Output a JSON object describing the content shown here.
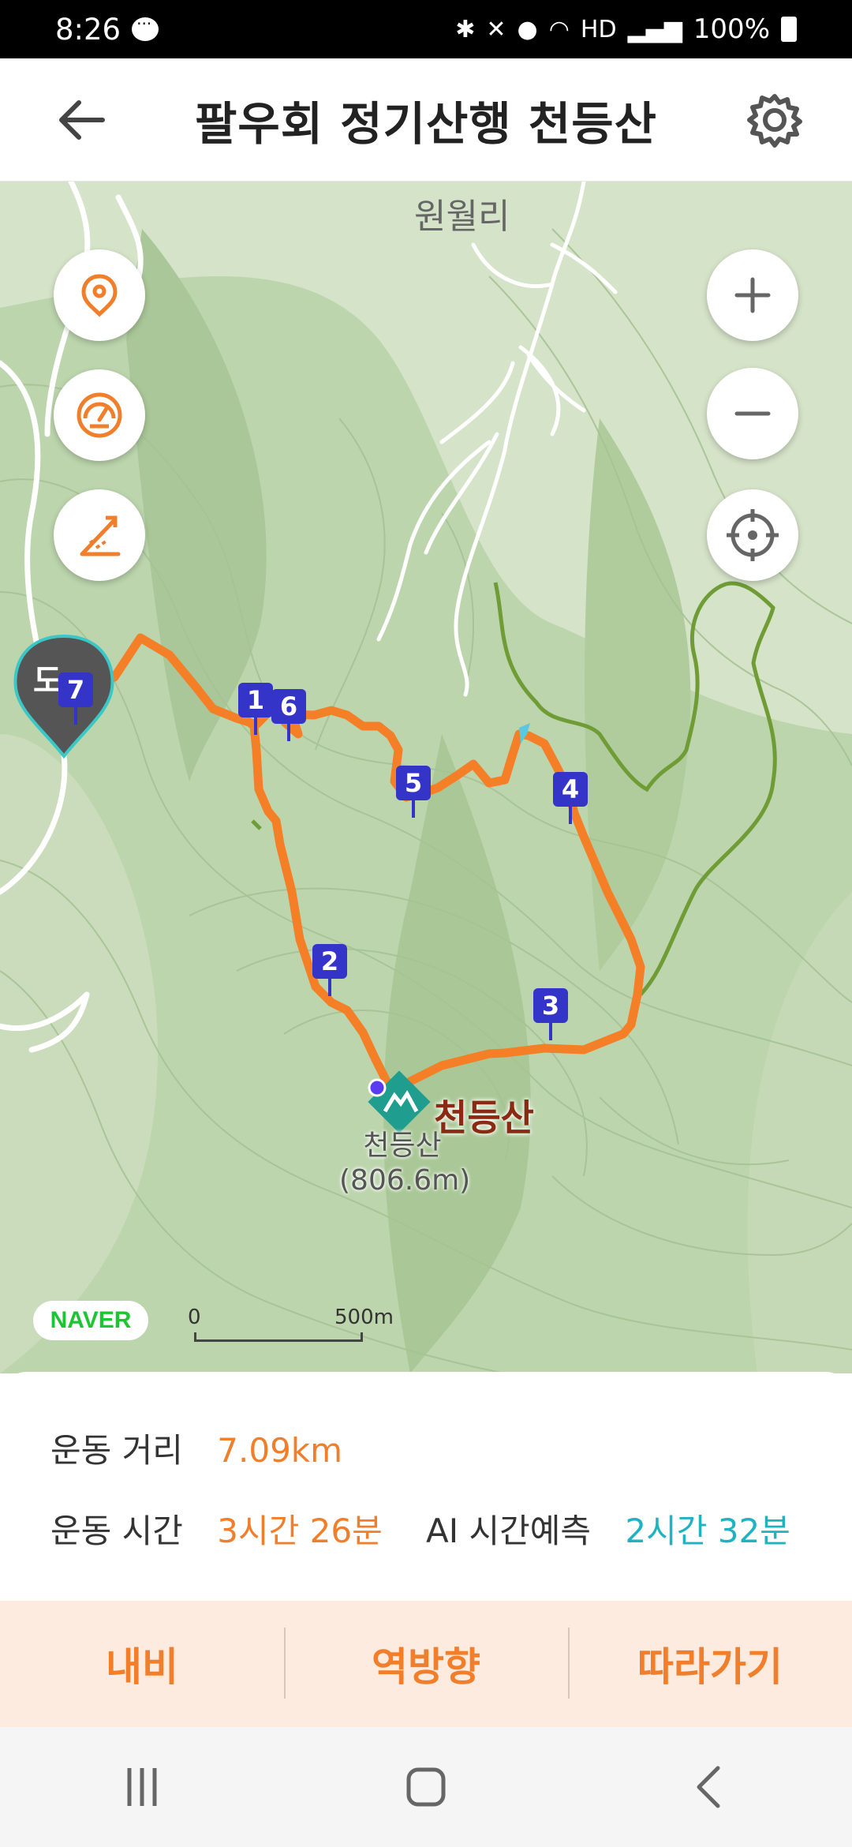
{
  "status_bar": {
    "time": "8:26",
    "battery": "100%",
    "network": "HD"
  },
  "header": {
    "title": "팔우회 정기산행 천등산"
  },
  "map": {
    "village_label": "원월리",
    "peak_name": "천등산",
    "peak_sublabel": "천등산",
    "peak_elevation": "(806.6m)",
    "start_label": "도",
    "provider": "NAVER",
    "scale_zero": "0",
    "scale_label": "500m",
    "markers": [
      "1",
      "2",
      "3",
      "4",
      "5",
      "6",
      "7"
    ],
    "colors": {
      "route": "#f47f27",
      "trail": "#6f9c35",
      "marker": "#3434c8",
      "accent": "#f07e2a",
      "ai": "#1fb3c2"
    },
    "tools": {
      "location_icon": "location-pin-icon",
      "speedometer_icon": "speedometer-icon",
      "slope_icon": "slope-angle-icon",
      "zoom_in_icon": "plus-icon",
      "zoom_out_icon": "minus-icon",
      "locate_icon": "crosshair-icon"
    }
  },
  "info": {
    "distance_label": "운동 거리",
    "distance_value": "7.09km",
    "time_label": "운동 시간",
    "time_value": "3시간 26분",
    "ai_label": "AI 시간예측",
    "ai_value": "2시간 32분"
  },
  "actions": {
    "navi": "내비",
    "reverse": "역방향",
    "follow": "따라가기"
  }
}
